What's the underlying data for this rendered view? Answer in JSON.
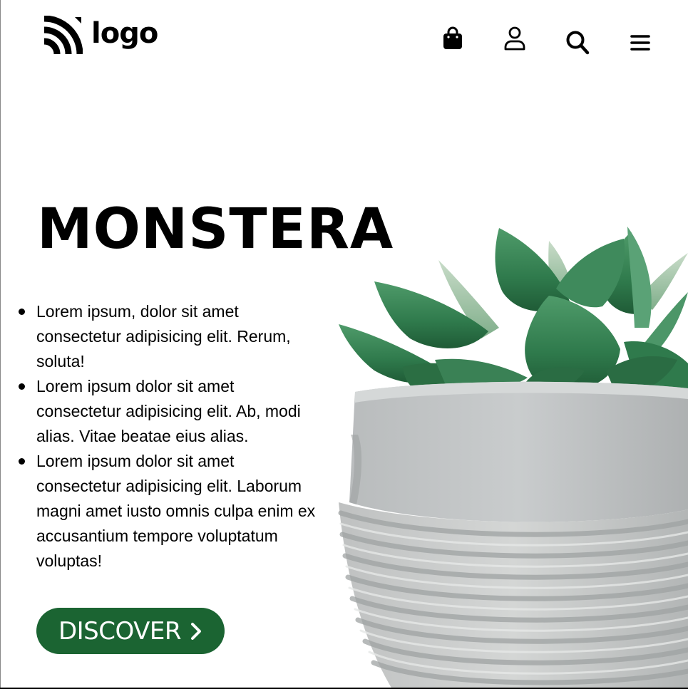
{
  "header": {
    "logo_text": "logo",
    "icons": {
      "bag": "shopping-bag-icon",
      "user": "user-icon",
      "search": "search-icon",
      "menu": "menu-icon"
    }
  },
  "hero": {
    "title": "MONSTERA",
    "features": [
      "Lorem ipsum, dolor sit amet consectetur adipisicing elit. Rerum, soluta!",
      "Lorem ipsum dolor sit amet consectetur adipisicing elit. Ab, modi alias. Vitae beatae eius alias.",
      "Lorem ipsum dolor sit amet consectetur adipisicing elit. Laborum magni amet iusto omnis culpa enim ex accusantium tempore voluptatum voluptas!"
    ],
    "cta_label": "DISCOVER"
  },
  "colors": {
    "accent": "#1b6432",
    "background": "#ffffff",
    "text": "#000000"
  }
}
